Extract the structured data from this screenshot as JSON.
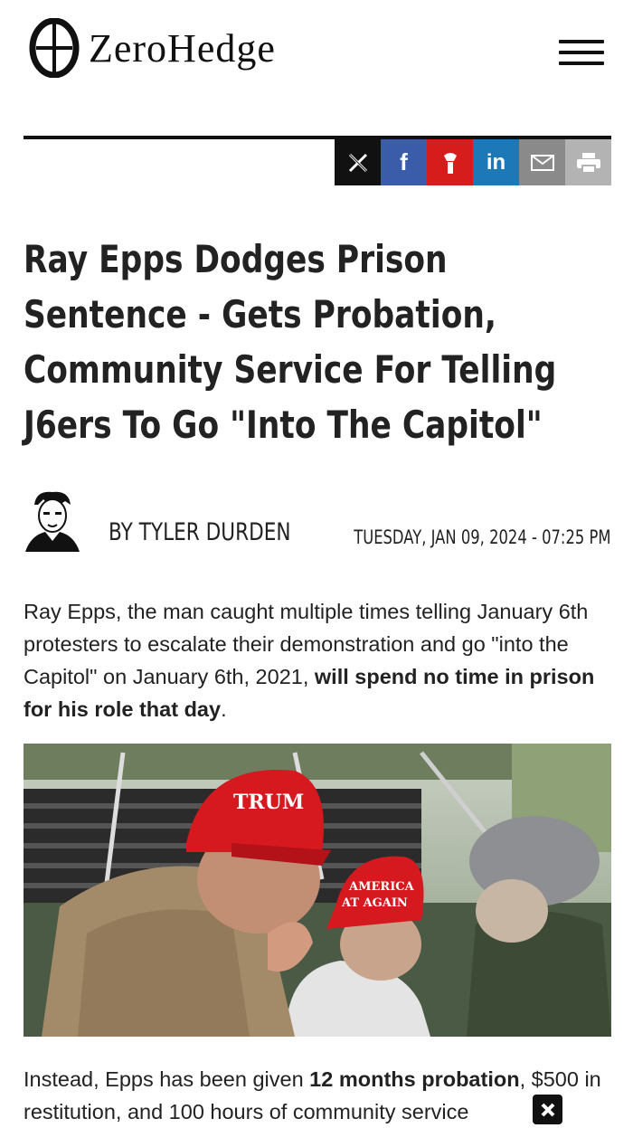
{
  "header": {
    "brand": "ZeroHedge",
    "logo_icon": "zerohedge-logo-icon",
    "menu_icon": "hamburger-menu-icon"
  },
  "share": {
    "buttons": [
      {
        "name": "x",
        "label": "X",
        "color": "#111111"
      },
      {
        "name": "facebook",
        "label": "f",
        "color": "#3b5ca8"
      },
      {
        "name": "gab",
        "label": "",
        "color": "#d71c1c"
      },
      {
        "name": "linkedin",
        "label": "in",
        "color": "#1c78b6"
      },
      {
        "name": "email",
        "label": "",
        "color": "#8a8a8a"
      },
      {
        "name": "print",
        "label": "",
        "color": "#b3b3b3"
      }
    ]
  },
  "article": {
    "title": "Ray Epps Dodges Prison Sentence - Gets Probation, Community Service For Telling J6ers To Go \"Into The Capitol\"",
    "author": "BY TYLER DURDEN",
    "date": "TUESDAY, JAN 09, 2024 - 07:25 PM",
    "p1_normal": "Ray Epps, the man caught multiple times telling January 6th protesters to escalate their demonstration and go \"into the Capitol\" on January 6th, 2021, ",
    "p1_bold": "will spend no time in prison for his role that day",
    "p1_end": ".",
    "photo_caps": {
      "cap1": "TRUM",
      "cap2_line1": "AMERICA",
      "cap2_line2": "AT AGAIN"
    },
    "p2_a": "Instead, Epps has been given ",
    "p2_bold": "12 months probation",
    "p2_b": ", $500 in restitution, and 100 hours of community service"
  }
}
